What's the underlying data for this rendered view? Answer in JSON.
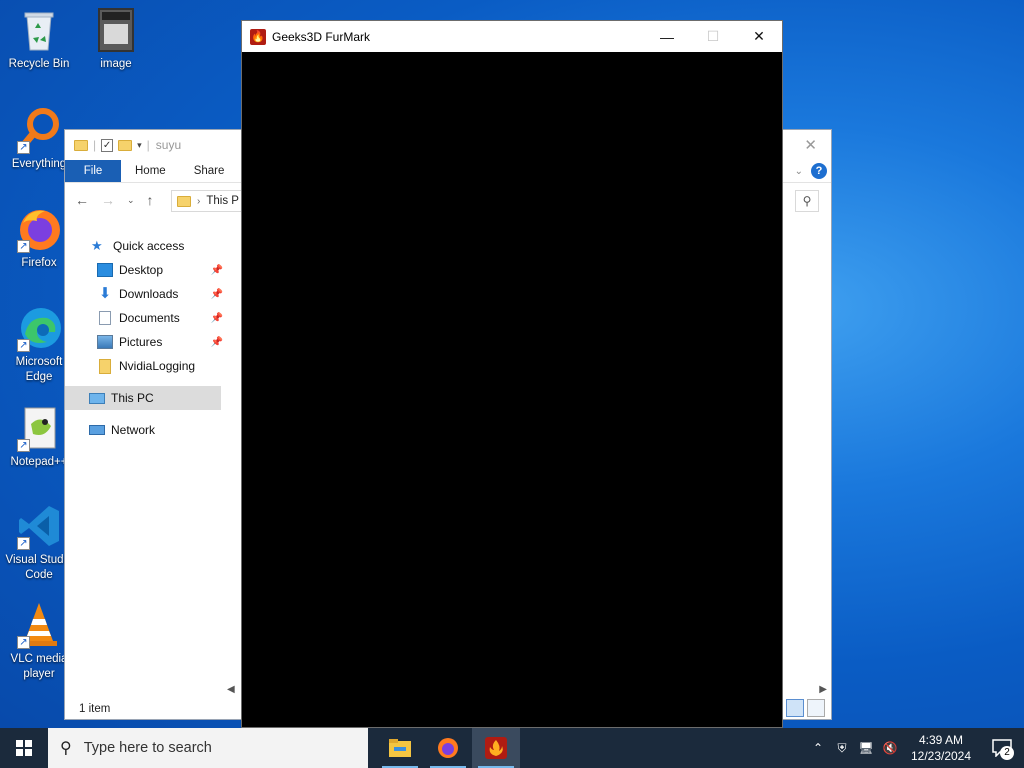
{
  "desktop": {
    "icons": [
      {
        "label": "Recycle Bin"
      },
      {
        "label": "image"
      },
      {
        "label": "Everything"
      },
      {
        "label": "Firefox"
      },
      {
        "label": "Microsoft Edge"
      },
      {
        "label": "Notepad++"
      },
      {
        "label": "Visual Studio Code"
      },
      {
        "label": "VLC media player"
      }
    ]
  },
  "explorer": {
    "title": "suyu",
    "tabs": [
      "File",
      "Home",
      "Share"
    ],
    "address": "This P",
    "nav": {
      "quick_access": "Quick access",
      "items": [
        "Desktop",
        "Downloads",
        "Documents",
        "Pictures",
        "NvidiaLogging"
      ],
      "this_pc": "This PC",
      "network": "Network"
    },
    "status": "1 item"
  },
  "furmark": {
    "title": "Geeks3D FurMark"
  },
  "taskbar": {
    "search_placeholder": "Type here to search",
    "clock_time": "4:39 AM",
    "clock_date": "12/23/2024",
    "notification_count": "2"
  }
}
